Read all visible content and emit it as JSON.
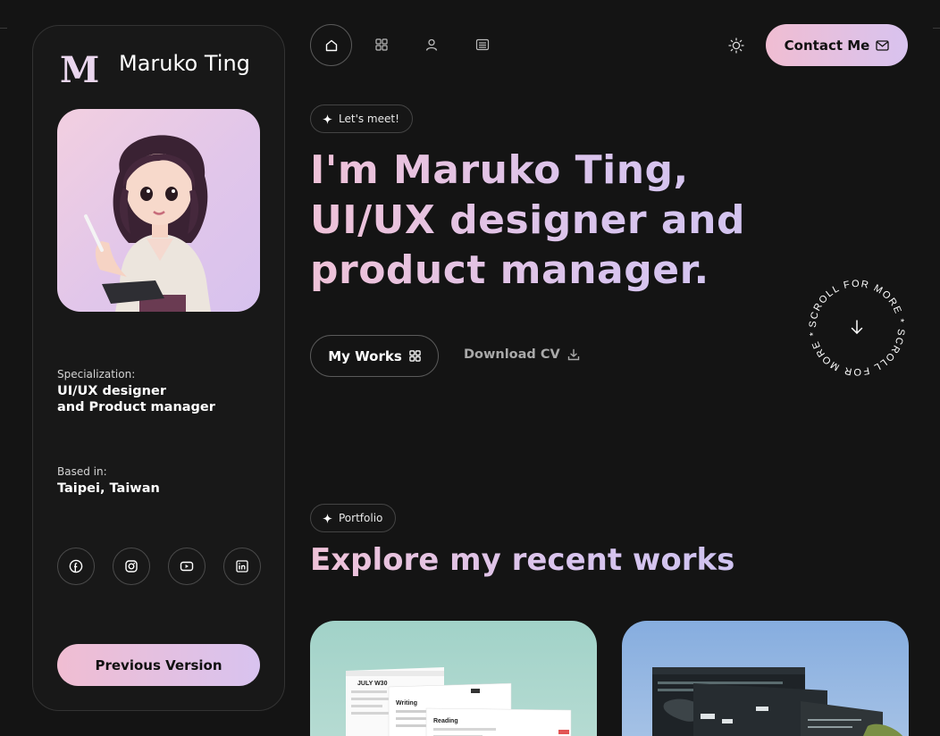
{
  "profile": {
    "logo": "M",
    "name": "Maruko Ting",
    "specialization_label": "Specialization:",
    "specialization_value_line1": "UI/UX designer",
    "specialization_value_line2": "and Product manager",
    "based_label": "Based in:",
    "based_value": "Taipei, Taiwan",
    "socials": [
      "facebook-icon",
      "instagram-icon",
      "youtube-icon",
      "linkedin-icon"
    ],
    "previous_version_label": "Previous Version"
  },
  "nav": {
    "items": [
      "home-icon",
      "grid-icon",
      "user-icon",
      "document-icon"
    ],
    "theme_toggle": "sun-icon",
    "contact_label": "Contact Me"
  },
  "hero": {
    "tag": "Let's meet!",
    "headline_line1": "I'm Maruko Ting,",
    "headline_line2": "UI/UX designer and",
    "headline_line3": "product manager.",
    "works_label": "My Works",
    "download_label": "Download CV",
    "scroll_text": "SCROLL FOR MORE * SCROLL FOR MORE * "
  },
  "portfolio": {
    "tag": "Portfolio",
    "title": "Explore my recent works",
    "card1_label1": "JULY W30",
    "card1_label2": "Writing",
    "card1_label3": "Reading"
  },
  "colors": {
    "background": "#141414",
    "accent_pink": "#efc2d8",
    "accent_lavender": "#d9c4ee"
  }
}
